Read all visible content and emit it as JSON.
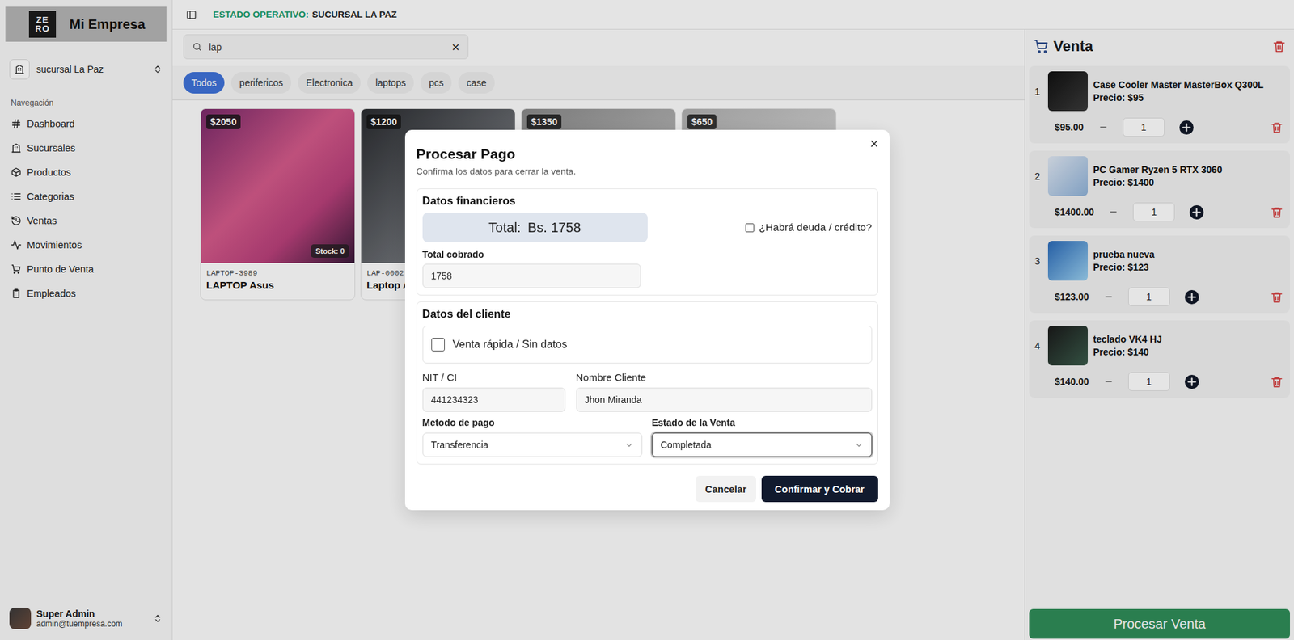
{
  "brand": {
    "logo_lines": [
      "ZE",
      "RO"
    ],
    "name": "Mi Empresa"
  },
  "branch_selector": {
    "label": "sucursal La Paz"
  },
  "nav": {
    "heading": "Navegación",
    "items": [
      {
        "label": "Dashboard",
        "selected": false
      },
      {
        "label": "Sucursales",
        "selected": false
      },
      {
        "label": "Productos",
        "selected": false
      },
      {
        "label": "Categorias",
        "selected": false
      },
      {
        "label": "Ventas",
        "selected": false
      },
      {
        "label": "Movimientos",
        "selected": false
      },
      {
        "label": "Punto de Venta",
        "selected": false
      },
      {
        "label": "Empleados",
        "selected": false
      }
    ]
  },
  "user": {
    "name": "Super Admin",
    "email": "admin@tuempresa.com"
  },
  "topbar": {
    "status_label": "ESTADO OPERATIVO:",
    "status_value": "SUCURSAL LA PAZ"
  },
  "search": {
    "value": "lap",
    "clear": "×"
  },
  "categories": [
    {
      "label": "Todos",
      "selected": true
    },
    {
      "label": "perifericos",
      "selected": false
    },
    {
      "label": "Electronica",
      "selected": false
    },
    {
      "label": "laptops",
      "selected": false
    },
    {
      "label": "pcs",
      "selected": false
    },
    {
      "label": "case",
      "selected": false
    }
  ],
  "products": [
    {
      "price": "$2050",
      "stock": "Stock: 0",
      "sku": "LAPTOP-3989",
      "name": "LAPTOP Asus"
    },
    {
      "price": "$1200",
      "sku": "LAP-0002",
      "name": "Laptop A"
    },
    {
      "price": "$1350"
    },
    {
      "price": "$650"
    }
  ],
  "cart": {
    "title": "Venta",
    "items": [
      {
        "index": "1",
        "name": "Case Cooler Master MasterBox Q300L",
        "price_label": "Precio: $95",
        "subtotal": "$95.00",
        "quantity": "1"
      },
      {
        "index": "2",
        "name": "PC Gamer Ryzen 5 RTX 3060",
        "price_label": "Precio: $1400",
        "subtotal": "$1400.00",
        "quantity": "1"
      },
      {
        "index": "3",
        "name": "prueba nueva",
        "price_label": "Precio: $123",
        "subtotal": "$123.00",
        "quantity": "1"
      },
      {
        "index": "4",
        "name": "teclado VK4 HJ",
        "price_label": "Precio: $140",
        "subtotal": "$140.00",
        "quantity": "1"
      }
    ],
    "process_button": "Procesar Venta"
  },
  "modal": {
    "title": "Procesar Pago",
    "subtitle": "Confirma los datos para cerrar la venta.",
    "close": "×",
    "financial": {
      "heading": "Datos financieros",
      "total_label": "Total:",
      "total_value": "Bs. 1758",
      "debt": {
        "label": "¿Habrá deuda / crédito?",
        "checked": false
      },
      "collected_label": "Total cobrado",
      "collected_value": "1758"
    },
    "client": {
      "heading": "Datos del cliente",
      "quick_sale": {
        "label": "Venta rápida / Sin datos",
        "checked": false
      },
      "fields": [
        {
          "label": "NIT / CI",
          "value": "441234323"
        },
        {
          "label": "Nombre Cliente",
          "value": "Jhon Miranda"
        }
      ],
      "selects": [
        {
          "label": "Metodo de pago",
          "value": "Transferencia",
          "focused": false
        },
        {
          "label": "Estado de la Venta",
          "value": "Completada",
          "focused": true
        }
      ]
    },
    "cancel": "Cancelar",
    "confirm": "Confirmar y Cobrar"
  }
}
